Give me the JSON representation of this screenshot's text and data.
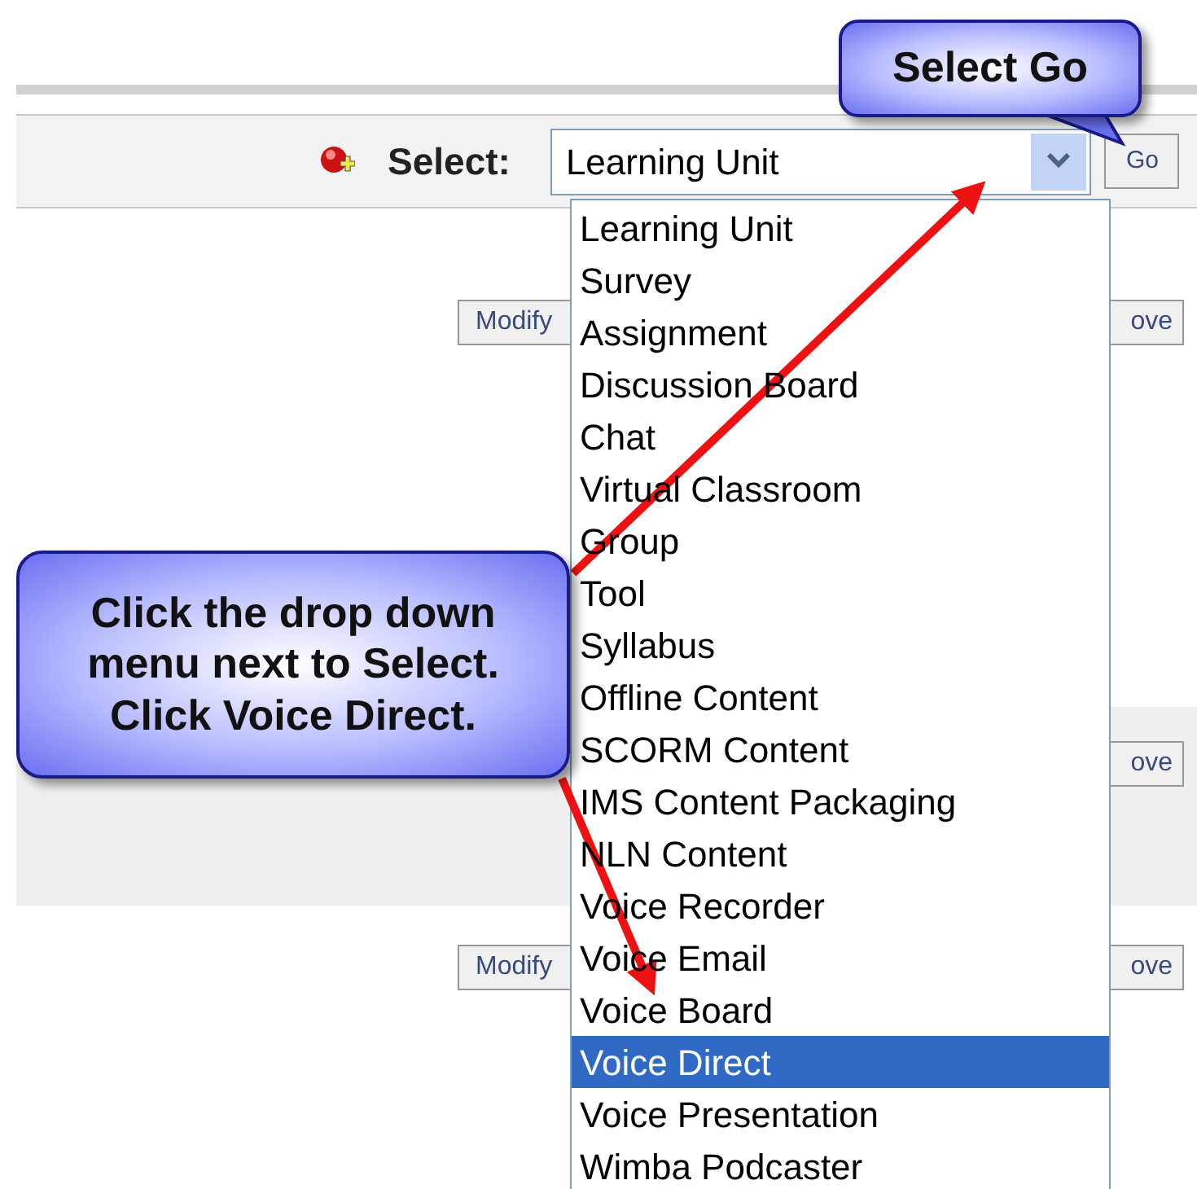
{
  "toolbar": {
    "label": "Select:",
    "value": "Learning Unit",
    "go_button": "Go"
  },
  "rows": [
    {
      "shaded": false,
      "left_button": "Modify",
      "right_button": "ove"
    },
    {
      "shaded": true,
      "right_button": "ove"
    },
    {
      "shaded": false,
      "left_button": "Modify",
      "right_button": "ove"
    }
  ],
  "dropdown": {
    "items": [
      {
        "label": "Learning Unit",
        "selected": false
      },
      {
        "label": "Survey",
        "selected": false
      },
      {
        "label": "Assignment",
        "selected": false
      },
      {
        "label": "Discussion Board",
        "selected": false
      },
      {
        "label": "Chat",
        "selected": false
      },
      {
        "label": "Virtual Classroom",
        "selected": false
      },
      {
        "label": "Group",
        "selected": false
      },
      {
        "label": "Tool",
        "selected": false
      },
      {
        "label": "Syllabus",
        "selected": false
      },
      {
        "label": "Offline Content",
        "selected": false
      },
      {
        "label": "SCORM Content",
        "selected": false
      },
      {
        "label": "IMS Content Packaging",
        "selected": false
      },
      {
        "label": "NLN Content",
        "selected": false
      },
      {
        "label": "Voice Recorder",
        "selected": false
      },
      {
        "label": "Voice Email",
        "selected": false
      },
      {
        "label": "Voice Board",
        "selected": false
      },
      {
        "label": "Voice Direct",
        "selected": true
      },
      {
        "label": "Voice Presentation",
        "selected": false
      },
      {
        "label": "Wimba Podcaster",
        "selected": false
      }
    ]
  },
  "callouts": [
    {
      "text": "Select Go"
    },
    {
      "text": "Click the drop down menu next to Select. Click Voice Direct."
    }
  ]
}
